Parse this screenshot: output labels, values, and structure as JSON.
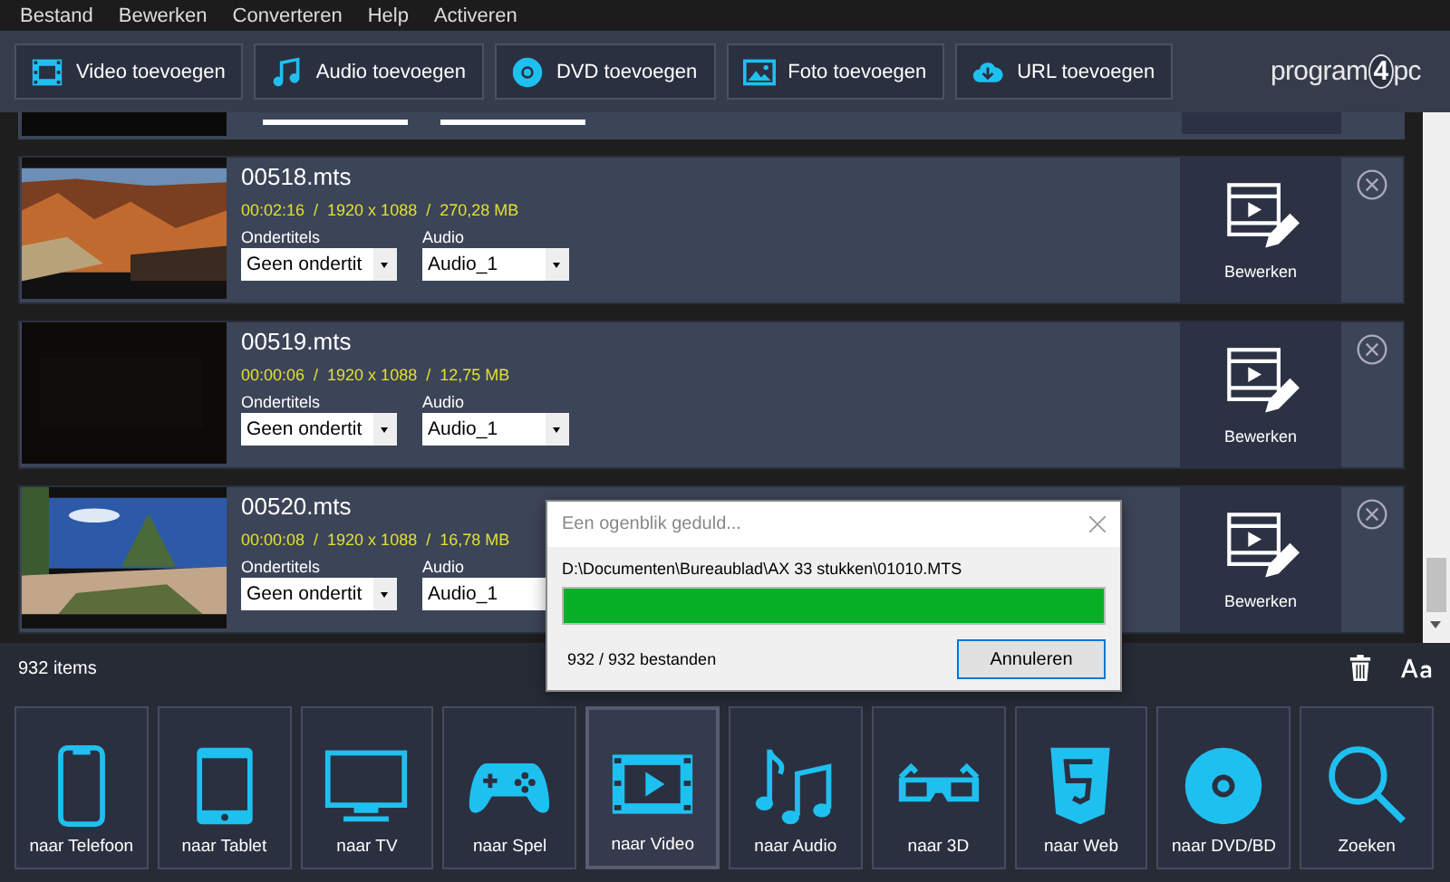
{
  "menu": [
    "Bestand",
    "Bewerken",
    "Converteren",
    "Help",
    "Activeren"
  ],
  "toolbar": [
    {
      "kind": "video",
      "label": "Video toevoegen"
    },
    {
      "kind": "audio",
      "label": "Audio toevoegen"
    },
    {
      "kind": "dvd",
      "label": "DVD toevoegen"
    },
    {
      "label": "Foto toevoegen"
    },
    {
      "kind": "url",
      "label": "URL toevoegen"
    }
  ],
  "logo": [
    "program",
    "4",
    "pc"
  ],
  "files": [
    {
      "name": "00518.mts",
      "details": "00:02:16  /  1920 x 1088  /  270,28 MB",
      "subtitles_label": "Ondertitels",
      "subtitles": "Geen ondertit",
      "audio_label": "Audio",
      "audio": "Audio_1",
      "edit": "Bewerken"
    },
    {
      "name": "00519.mts",
      "details": "00:00:06  /  1920 x 1088  /  12,75 MB",
      "subtitles_label": "Ondertitels",
      "subtitles": "Geen ondertit",
      "audio_label": "Audio",
      "audio": "Audio_1",
      "edit": "Bewerken"
    },
    {
      "name": "00520.mts",
      "details": "00:00:08  /  1920 x 1088  /  16,78 MB",
      "subtitles_label": "Ondertitels",
      "subtitles": "Geen ondertit",
      "audio_label": "Audio",
      "audio": "Audio_1",
      "edit": "Bewerken"
    }
  ],
  "status": {
    "count": "932 items"
  },
  "dialog": {
    "title": "Een ogenblik geduld...",
    "path": "D:\\Documenten\\Bureaublad\\AX 33 stukken\\01010.MTS",
    "level": 1,
    "progress": "932 / 932  bestanden",
    "button": "Annuleren"
  },
  "targets": [
    {
      "kind": "phone",
      "label": "naar Telefoon",
      "selected": false
    },
    {
      "kind": "tablet",
      "label": "naar Tablet",
      "selected": false
    },
    {
      "kind": "tv",
      "label": "naar TV",
      "selected": false
    },
    {
      "kind": "game",
      "label": "naar Spel",
      "selected": false
    },
    {
      "kind": "video",
      "label": "naar Video",
      "selected": true
    },
    {
      "kind": "music",
      "label": "naar Audio",
      "selected": false
    },
    {
      "kind": "glasses",
      "label": "naar 3D",
      "selected": false
    },
    {
      "kind": "web",
      "label": "naar Web",
      "selected": false
    },
    {
      "kind": "disc",
      "label": "naar DVD/BD",
      "selected": false
    },
    {
      "kind": "search",
      "label": "Zoeken",
      "selected": false
    }
  ]
}
